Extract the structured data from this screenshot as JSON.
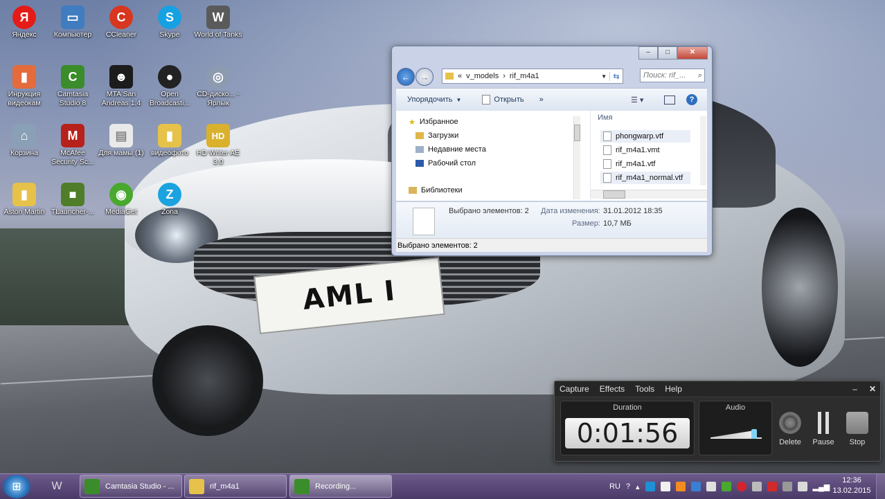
{
  "desktop": {
    "plate_text": "AML I",
    "icons": [
      {
        "label": "Яндекс",
        "glyph": "Я",
        "color": "#e41b17"
      },
      {
        "label": "Компьютер",
        "glyph": "▭",
        "color": "#3f7cc0"
      },
      {
        "label": "CCleaner",
        "glyph": "C",
        "color": "#d8361f"
      },
      {
        "label": "Skype",
        "glyph": "S",
        "color": "#16a1e3"
      },
      {
        "label": "World of Tanks",
        "glyph": "W",
        "color": "#5a5a5a"
      },
      {
        "label": "Инрукция видеокам",
        "glyph": "▮",
        "color": "#e46b3c"
      },
      {
        "label": "Camtasia Studio 8",
        "glyph": "C",
        "color": "#3b8c2a"
      },
      {
        "label": "MTA San Andreas 1.4",
        "glyph": "☻",
        "color": "#1c1c1c"
      },
      {
        "label": "Open Broadcasti...",
        "glyph": "●",
        "color": "#222222"
      },
      {
        "label": "CD-диско... - Ярлык",
        "glyph": "◎",
        "color": "#8c9bb0"
      },
      {
        "label": "Корзина",
        "glyph": "⌂",
        "color": "#8aa0b6"
      },
      {
        "label": "McAfee Security Sc...",
        "glyph": "M",
        "color": "#b7211c"
      },
      {
        "label": "Для мамы (1)",
        "glyph": "▤",
        "color": "#e9e9e9"
      },
      {
        "label": "видеофото",
        "glyph": "▮",
        "color": "#e6c24a"
      },
      {
        "label": "HD Writer AE 3.0",
        "glyph": "HD",
        "color": "#d9b12c"
      },
      {
        "label": "Aston Martin",
        "glyph": "▮",
        "color": "#e6c24a"
      },
      {
        "label": "TLauncher-...",
        "glyph": "■",
        "color": "#4f7d2a"
      },
      {
        "label": "MediaGet",
        "glyph": "◉",
        "color": "#49a82e"
      },
      {
        "label": "Zona",
        "glyph": "Z",
        "color": "#1ba3e0"
      }
    ]
  },
  "explorer": {
    "address": {
      "parts": [
        "«",
        "v_models",
        "›",
        "rif_m4a1"
      ]
    },
    "search_placeholder": "Поиск: rif_...",
    "toolbar": {
      "organize": "Упорядочить",
      "open": "Открыть",
      "more": "»"
    },
    "nav_tree": [
      {
        "label": "Избранное"
      },
      {
        "label": "Загрузки"
      },
      {
        "label": "Недавние места"
      },
      {
        "label": "Рабочий стол"
      },
      {
        "label": "Библиотеки"
      }
    ],
    "column_header": "Имя",
    "files": [
      "phongwarp.vtf",
      "rif_m4a1.vmt",
      "rif_m4a1.vtf",
      "rif_m4a1_normal.vtf"
    ],
    "details": {
      "selected": "Выбрано элементов: 2",
      "date_label": "Дата изменения:",
      "date_value": "31.01.2012 18:35",
      "size_label": "Размер:",
      "size_value": "10,7 МБ"
    },
    "status": "Выбрано элементов: 2"
  },
  "recorder": {
    "menu": [
      "Capture",
      "Effects",
      "Tools",
      "Help"
    ],
    "duration_label": "Duration",
    "duration_value": "0:01:56",
    "audio_label": "Audio",
    "audio_level": 0.85,
    "buttons": {
      "delete": "Delete",
      "pause": "Pause",
      "stop": "Stop"
    }
  },
  "taskbar": {
    "tasks": [
      "Camtasia Studio - ...",
      "rif_m4a1",
      "Recording..."
    ],
    "language": "RU",
    "time": "12:36",
    "date": "13.02.2015"
  }
}
